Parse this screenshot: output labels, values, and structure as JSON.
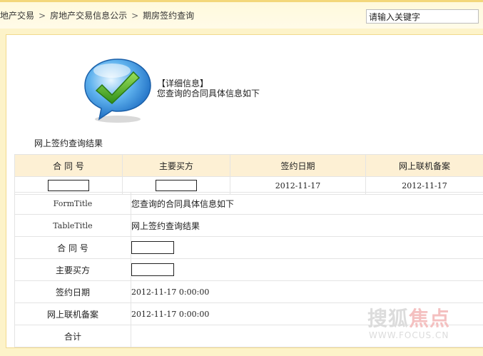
{
  "breadcrumb": {
    "items": [
      "地产交易",
      "房地产交易信息公示",
      "期房签约查询"
    ],
    "separator": ">"
  },
  "search": {
    "value": "请输入关键字"
  },
  "info": {
    "icon": "checkmark-speech-bubble-icon",
    "title": "【详细信息】",
    "subtitle": "您查询的合同具体信息如下"
  },
  "section_label": "网上签约查询结果",
  "results_table": {
    "headers": [
      "合 同 号",
      "主要买方",
      "签约日期",
      "网上联机备案"
    ],
    "row": {
      "sign_date": "2012-11-17",
      "filing_date": "2012-11-17"
    }
  },
  "detail_table": {
    "rows": [
      {
        "key": "FormTitle",
        "value": "您查询的合同具体信息如下"
      },
      {
        "key": "TableTitle",
        "value": "网上签约查询结果"
      },
      {
        "key": "合 同 号",
        "value": ""
      },
      {
        "key": "主要买方",
        "value": ""
      },
      {
        "key": "签约日期",
        "value": "2012-11-17 0:00:00"
      },
      {
        "key": "网上联机备案",
        "value": "2012-11-17 0:00:00"
      },
      {
        "key": "合计",
        "value": ""
      }
    ]
  },
  "watermark": {
    "text_a": "搜狐",
    "text_b": "焦点",
    "url": "WWW.FOCUS.CN"
  },
  "colors": {
    "accent": "#f3d77a",
    "panel_bg": "#fdf3c9",
    "header_bg": "#fdf0d4"
  }
}
